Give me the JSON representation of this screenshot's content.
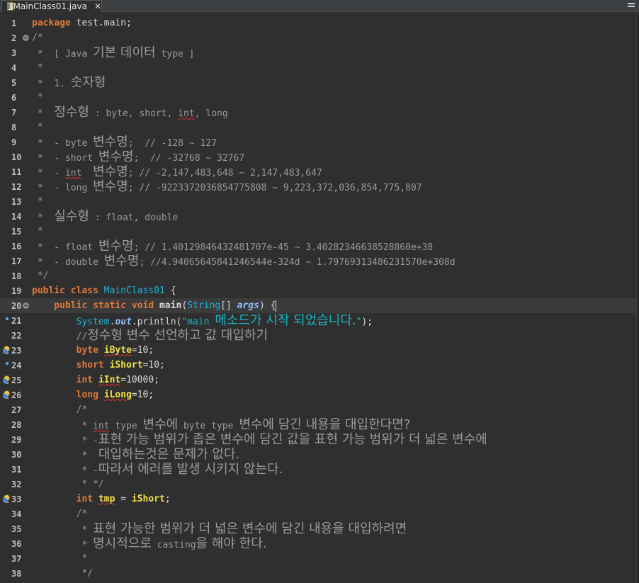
{
  "editor_tab": {
    "title": "MainClass01.java",
    "close_glyph": "✕",
    "icon": "java-file-icon"
  },
  "window_controls": {
    "icon": "minimize-icon"
  },
  "lines": [
    {
      "n": "1",
      "text": "package test.main;"
    },
    {
      "n": "2",
      "text": "/*"
    },
    {
      "n": "3",
      "text": " *  [ Java 기본 데이터 type ]"
    },
    {
      "n": "4",
      "text": " *"
    },
    {
      "n": "5",
      "text": " *  1. 숫자형"
    },
    {
      "n": "6",
      "text": " *"
    },
    {
      "n": "7",
      "text": " *  정수형 : byte, short, int, long"
    },
    {
      "n": "8",
      "text": " *"
    },
    {
      "n": "9",
      "text": " *  - byte 변수명;  // -128 ~ 127"
    },
    {
      "n": "10",
      "text": " *  - short 변수명;  // -32768 ~ 32767"
    },
    {
      "n": "11",
      "text": " *  - int  변수명; // -2,147,483,648 ~ 2,147,483,647"
    },
    {
      "n": "12",
      "text": " *  - long 변수명; // -9223372036854775808 ~ 9,223,372,036,854,775,807"
    },
    {
      "n": "13",
      "text": " *"
    },
    {
      "n": "14",
      "text": " *  실수형 : float, double"
    },
    {
      "n": "15",
      "text": " *"
    },
    {
      "n": "16",
      "text": " *  - float 변수명; // 1.40129846432481707e-45 ~ 3.40282346638528860e+38"
    },
    {
      "n": "17",
      "text": " *  - double 변수명; //4.94065645841246544e-324d ~ 1.79769313486231570e+308d"
    },
    {
      "n": "18",
      "text": " */"
    },
    {
      "n": "19",
      "text": "public class MainClass01 {"
    },
    {
      "n": "20",
      "text": "    public static void main(String[] args) {"
    },
    {
      "n": "21",
      "text": "        System.out.println(\"main 메소드가 시작 되었습니다.\");"
    },
    {
      "n": "22",
      "text": "        //정수형 변수 선언하고 값 대입하기"
    },
    {
      "n": "23",
      "text": "        byte iByte=10;"
    },
    {
      "n": "24",
      "text": "        short iShort=10;"
    },
    {
      "n": "25",
      "text": "        int iInt=10000;"
    },
    {
      "n": "26",
      "text": "        long iLong=10;"
    },
    {
      "n": "27",
      "text": "        /*"
    },
    {
      "n": "28",
      "text": "         * int type 변수에 byte type 변수에 담긴 내용을 대입한다면?"
    },
    {
      "n": "29",
      "text": "         * -표현 가능 범위가 좁은 변수에 담긴 값을 표현 가능 범위가 더 넓은 변수에"
    },
    {
      "n": "30",
      "text": "         *  대입하는것은 문제가 없다."
    },
    {
      "n": "31",
      "text": "         * -따라서 에러를 발생 시키지 않는다."
    },
    {
      "n": "32",
      "text": "         * */"
    },
    {
      "n": "33",
      "text": "        int tmp = iShort;"
    },
    {
      "n": "34",
      "text": "        /*"
    },
    {
      "n": "35",
      "text": "         * 표현 가능한 범위가 더 넓은 변수에 담긴 내용을 대입하려면"
    },
    {
      "n": "36",
      "text": "         * 명시적으로 casting을 해야 한다."
    },
    {
      "n": "37",
      "text": "         *"
    },
    {
      "n": "38",
      "text": "         */"
    }
  ],
  "tokens": {
    "l1": [
      "package",
      " test.main;"
    ],
    "l3": [
      " *  [ Java ",
      "기본 데이터",
      " type ]"
    ],
    "l5": [
      " *  1. ",
      "숫자형"
    ],
    "l7": [
      " *  ",
      "정수형",
      " : byte, short, ",
      "int",
      ", long"
    ],
    "l9": [
      " *  - byte ",
      "변수명",
      ";  // -128 ~ 127"
    ],
    "l10": [
      " *  - short ",
      "변수명",
      ";  // -32768 ~ 32767"
    ],
    "l11": [
      " *  - ",
      "int",
      "  ",
      "변수명",
      "; // -2,147,483,648 ~ 2,147,483,647"
    ],
    "l12": [
      " *  - long ",
      "변수명",
      "; // -9223372036854775808 ~ 9,223,372,036,854,775,807"
    ],
    "l14": [
      " *  ",
      "실수형",
      " : float, double"
    ],
    "l16": [
      " *  - float ",
      "변수명",
      "; // 1.40129846432481707e-45 ~ 3.40282346638528860e+38"
    ],
    "l17": [
      " *  - double ",
      "변수명",
      "; //4.94065645841246544e-324d ~ 1.79769313486231570e+308d"
    ],
    "l19": [
      "public class",
      " ",
      "MainClass01",
      " {"
    ],
    "l20": [
      "    ",
      "public static void",
      " ",
      "main",
      "(",
      "String",
      "[] ",
      "args",
      ") {"
    ],
    "l21": [
      "        ",
      "System",
      ".",
      "out",
      ".println(",
      "\"main ",
      "메소드가 시작 되었습니다.",
      "\"",
      ");"
    ],
    "l22": [
      "        //",
      "정수형 변수 선언하고 값 대입하기"
    ],
    "l23": [
      "        ",
      "byte",
      " ",
      "iByte",
      "=10;"
    ],
    "l24": [
      "        ",
      "short",
      " ",
      "iShort",
      "=10;"
    ],
    "l25": [
      "        ",
      "int",
      " ",
      "iInt",
      "=10000;"
    ],
    "l26": [
      "        ",
      "long",
      " ",
      "iLong",
      "=10;"
    ],
    "l28": [
      "         * ",
      "int",
      " type ",
      "변수에",
      " byte type ",
      "변수에 담긴 내용을 대입한다면?"
    ],
    "l29": [
      "         * -",
      "표현 가능 범위가 좁은 변수에 담긴 값을 표현 가능 범위가 더 넓은 변수에"
    ],
    "l30": [
      "         *  ",
      "대입하는것은 문제가 없다."
    ],
    "l31": [
      "         * -",
      "따라서 에러를 발생 시키지 않는다."
    ],
    "l33": [
      "        ",
      "int",
      " ",
      "tmp",
      " = ",
      "iShort",
      ";"
    ],
    "l35": [
      "         * ",
      "표현 가능한 범위가 더 넓은 변수에 담긴 내용을 대입하려면"
    ],
    "l36": [
      "         * ",
      "명시적으로",
      " casting",
      "을 해야 한다."
    ]
  },
  "markers": {
    "fold_lines": [
      "2",
      "20"
    ],
    "warning_lines": [
      "23",
      "25",
      "26",
      "33"
    ],
    "info_lines": [
      "21",
      "24"
    ],
    "current_line": "20"
  },
  "colors": {
    "background": "#2f2f2f",
    "keyword": "#e0783b",
    "class_name": "#1eb4d8",
    "comment": "#9a9a9a",
    "string": "#18b4c4",
    "variable": "#f0e14a"
  }
}
